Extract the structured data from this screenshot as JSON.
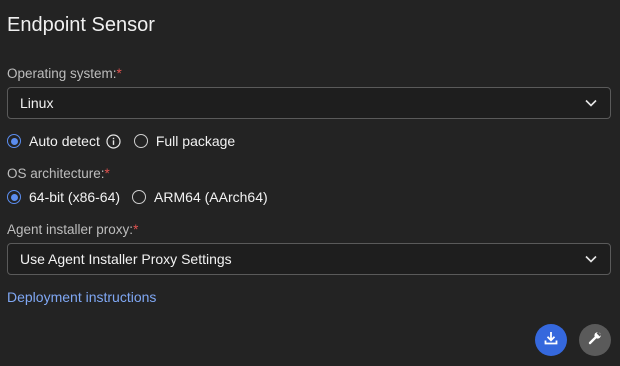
{
  "title": "Endpoint Sensor",
  "os": {
    "label": "Operating system:",
    "required_mark": "*",
    "value": "Linux"
  },
  "package": {
    "options": [
      {
        "label": "Auto detect",
        "checked": true,
        "info_icon": "info-icon"
      },
      {
        "label": "Full package",
        "checked": false
      }
    ]
  },
  "arch": {
    "label": "OS architecture:",
    "required_mark": "*",
    "options": [
      {
        "label": "64-bit (x86-64)",
        "checked": true
      },
      {
        "label": "ARM64 (AArch64)",
        "checked": false
      }
    ]
  },
  "proxy": {
    "label": "Agent installer proxy:",
    "required_mark": "*",
    "value": "Use Agent Installer Proxy Settings"
  },
  "link": "Deployment instructions",
  "actions": {
    "download_icon": "download-icon",
    "wrench_icon": "wrench-icon"
  },
  "colors": {
    "background": "#232323",
    "accent": "#5b8def",
    "link": "#7fa7f3",
    "required": "#e0524f",
    "download_button": "#3568dd"
  }
}
